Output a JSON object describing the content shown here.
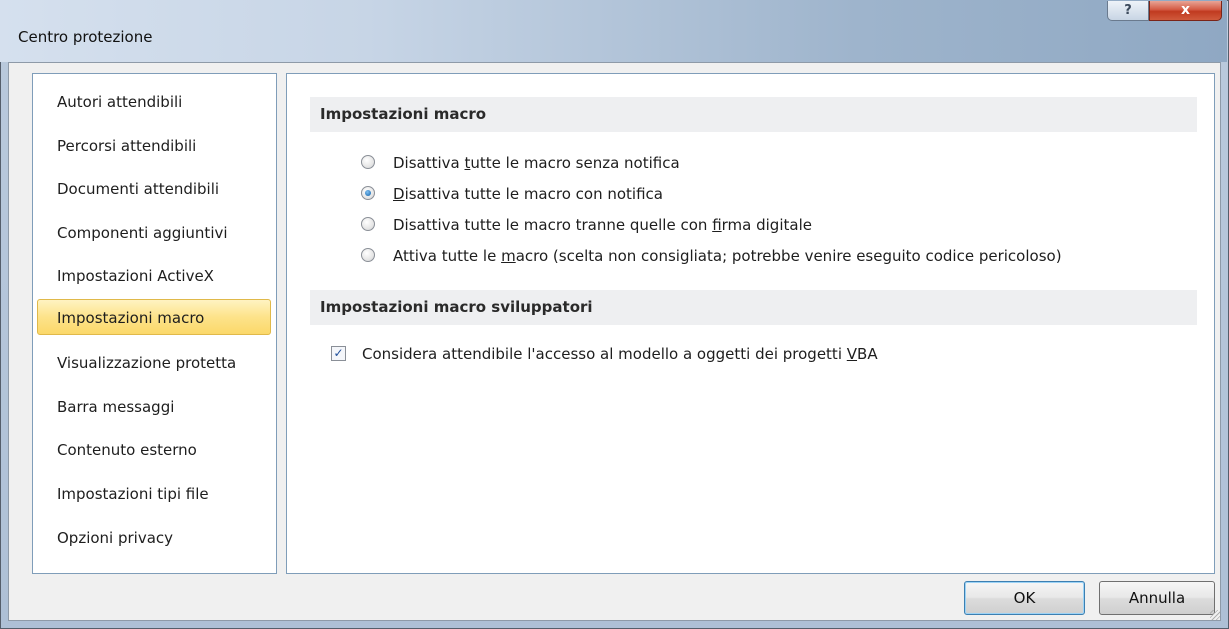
{
  "window": {
    "title": "Centro protezione",
    "help_label": "?",
    "close_label": "x"
  },
  "sidebar": {
    "items": [
      {
        "label": "Autori attendibili",
        "selected": false
      },
      {
        "label": "Percorsi attendibili",
        "selected": false
      },
      {
        "label": "Documenti attendibili",
        "selected": false
      },
      {
        "label": "Componenti aggiuntivi",
        "selected": false
      },
      {
        "label": "Impostazioni ActiveX",
        "selected": false
      },
      {
        "label": "Impostazioni macro",
        "selected": true
      },
      {
        "label": "Visualizzazione protetta",
        "selected": false
      },
      {
        "label": "Barra messaggi",
        "selected": false
      },
      {
        "label": "Contenuto esterno",
        "selected": false
      },
      {
        "label": "Impostazioni tipi file",
        "selected": false
      },
      {
        "label": "Opzioni privacy",
        "selected": false
      }
    ]
  },
  "macro_settings": {
    "header": "Impostazioni macro",
    "options": [
      {
        "pre": "Disattiva ",
        "key": "t",
        "post": "utte le macro senza notifica",
        "checked": false
      },
      {
        "pre": "",
        "key": "D",
        "post": "isattiva tutte le macro con notifica",
        "checked": true
      },
      {
        "pre": "Disattiva tutte le macro tranne quelle con ",
        "key": "f",
        "post": "irma digitale",
        "checked": false
      },
      {
        "pre": "Attiva tutte le ",
        "key": "m",
        "post": "acro (scelta non consigliata; potrebbe venire eseguito codice pericoloso)",
        "checked": false
      }
    ]
  },
  "developer_settings": {
    "header": "Impostazioni macro sviluppatori",
    "vba_access": {
      "pre": "Considera attendibile l'accesso al modello a oggetti dei progetti ",
      "key": "V",
      "post": "BA",
      "checked": true
    }
  },
  "buttons": {
    "ok_label": "OK",
    "cancel_label": "Annulla"
  },
  "colors": {
    "selected_item": "#fde38a",
    "close_button": "#c03a20",
    "default_button_border": "#3c7fb1"
  }
}
